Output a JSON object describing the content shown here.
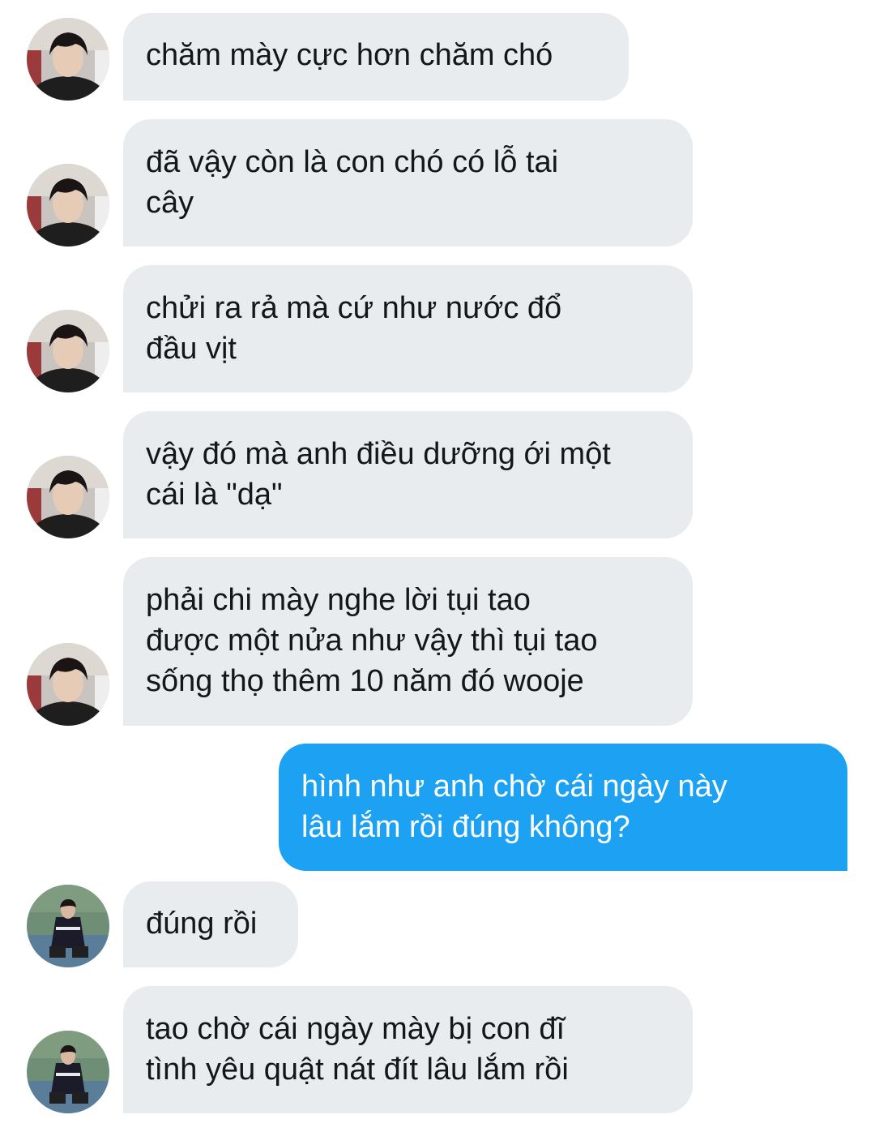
{
  "conversation": {
    "messages": [
      {
        "sender": "received",
        "avatar": "avatar-1-icon",
        "text": "chăm mày cực hơn chăm chó"
      },
      {
        "sender": "received",
        "avatar": "avatar-1-icon",
        "text": "đã vậy còn là con chó có lỗ tai\ncây"
      },
      {
        "sender": "received",
        "avatar": "avatar-1-icon",
        "text": "chửi ra rả mà cứ như nước đổ\nđầu vịt"
      },
      {
        "sender": "received",
        "avatar": "avatar-1-icon",
        "text": "vậy đó mà anh điều dưỡng ới một\ncái là \"dạ\""
      },
      {
        "sender": "received",
        "avatar": "avatar-1-icon",
        "text": "phải chi mày nghe lời tụi tao\nđược một nửa như vậy thì tụi tao\nsống thọ thêm 10 năm đó wooje"
      },
      {
        "sender": "sent",
        "text": "hình như anh chờ cái ngày này\nlâu lắm rồi đúng không?"
      },
      {
        "sender": "received",
        "avatar": "avatar-2-icon",
        "text": "đúng rồi"
      },
      {
        "sender": "received",
        "avatar": "avatar-2-icon",
        "text": "tao chờ cái ngày mày bị con đĩ\ntình yêu quật nát đít lâu lắm rồi"
      }
    ]
  },
  "colors": {
    "received_bubble": "#e8ecef",
    "sent_bubble": "#1da1f2",
    "received_text": "#14171a",
    "sent_text": "#ffffff"
  }
}
